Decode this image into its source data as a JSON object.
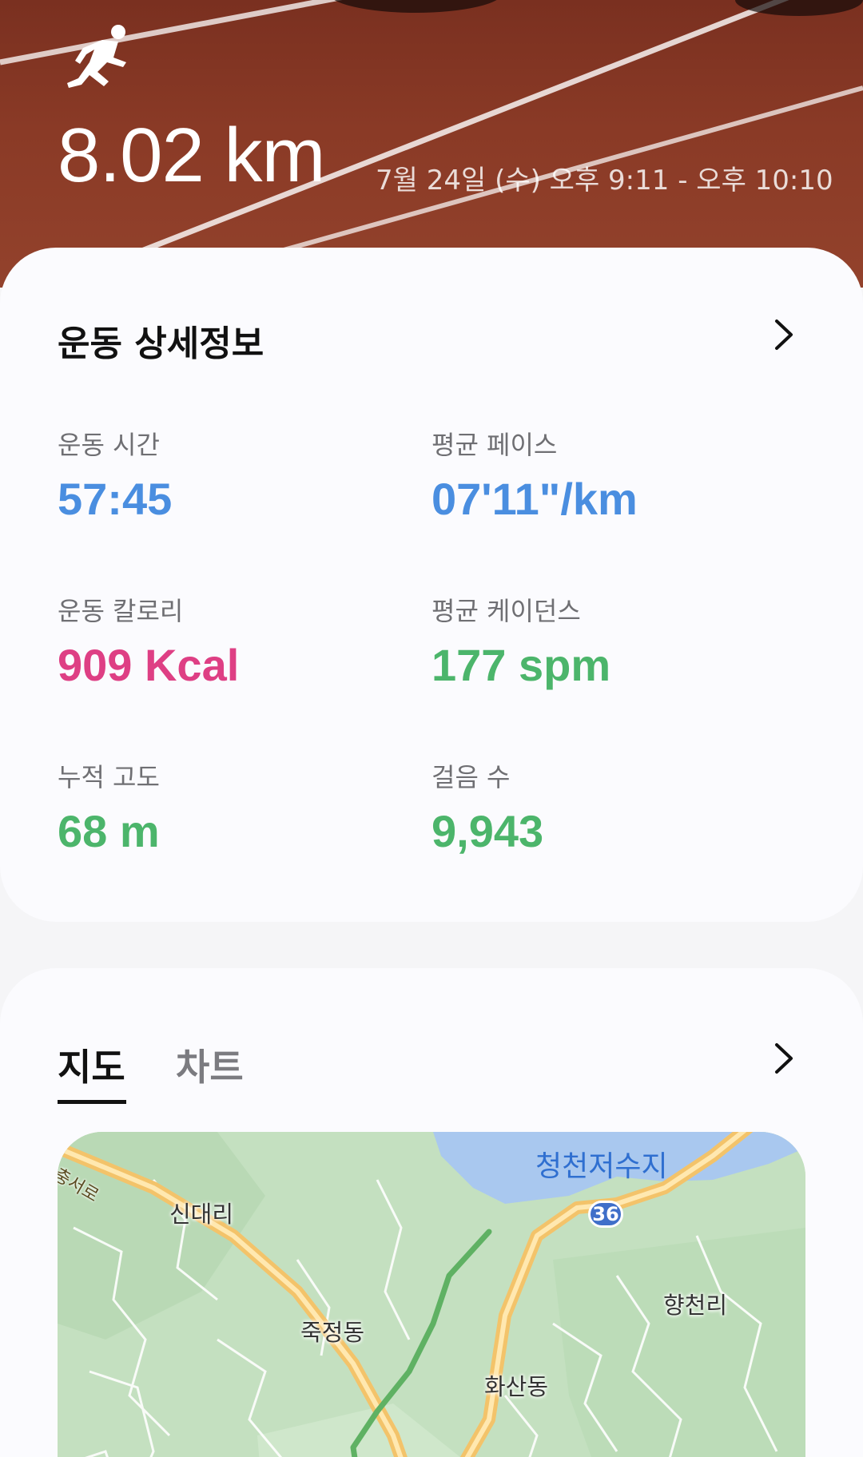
{
  "hero": {
    "icon": "running-person-icon",
    "distance": "8.02 km",
    "datetime": "7월 24일 (수) 오후 9:11 - 오후 10:10"
  },
  "details": {
    "title": "운동 상세정보",
    "chevron_icon": "chevron-right-icon",
    "stats": [
      {
        "label": "운동 시간",
        "value": "57:45",
        "color": "#4a8ee0"
      },
      {
        "label": "평균 페이스",
        "value": "07'11\"/km",
        "color": "#4a8ee0"
      },
      {
        "label": "운동 칼로리",
        "value": "909 Kcal",
        "color": "#de3f84"
      },
      {
        "label": "평균 케이던스",
        "value": "177 spm",
        "color": "#4cb56b"
      },
      {
        "label": "누적 고도",
        "value": "68 m",
        "color": "#4cb56b"
      },
      {
        "label": "걸음 수",
        "value": "9,943",
        "color": "#4cb56b"
      }
    ]
  },
  "map_section": {
    "tabs": [
      {
        "label": "지도",
        "selected": true
      },
      {
        "label": "차트",
        "selected": false
      }
    ],
    "chevron_icon": "chevron-right-icon",
    "map": {
      "reservoir": "청천저수지",
      "road_number": "36",
      "road_name": "충서로",
      "places": [
        "신대리",
        "죽정동",
        "향천리",
        "화산동"
      ]
    }
  }
}
